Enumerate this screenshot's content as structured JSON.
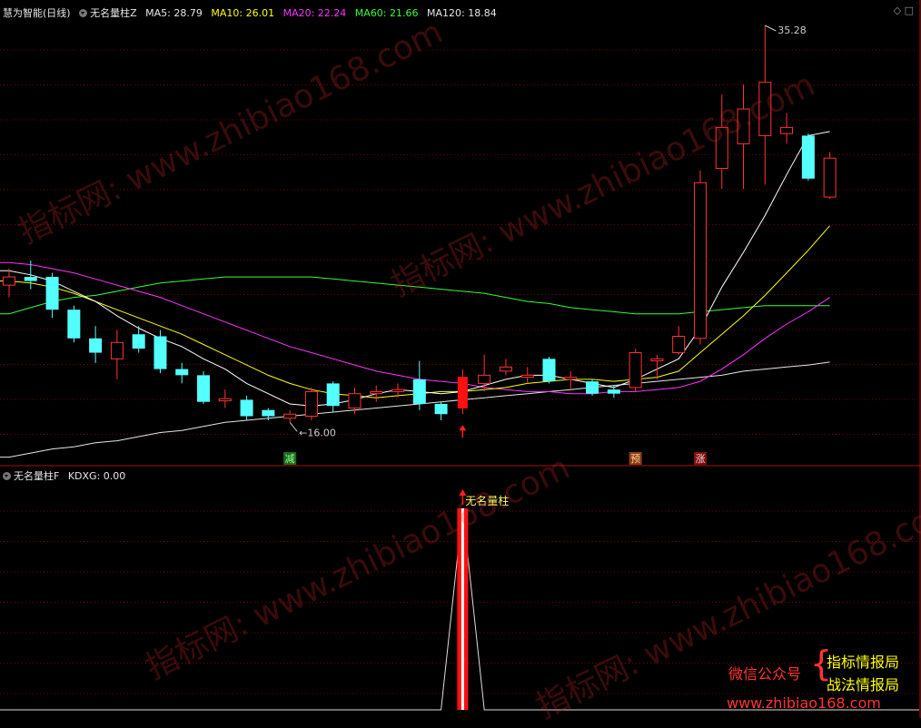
{
  "app": {
    "title": "慧为智能(日线)"
  },
  "main_panel": {
    "indicator_name": "无名量柱Z",
    "ma": [
      {
        "label": "MA5: 28.79",
        "color": "#ffffff"
      },
      {
        "label": "MA10: 26.01",
        "color": "#ffff00"
      },
      {
        "label": "MA20: 22.24",
        "color": "#ff33ff"
      },
      {
        "label": "MA60: 21.66",
        "color": "#33ff33"
      },
      {
        "label": "MA120: 18.84",
        "color": "#e6e6e6"
      }
    ],
    "high_label": "35.28",
    "low_label": "16.00",
    "signal_tags": [
      "减",
      "预",
      "涨"
    ]
  },
  "sub_panel": {
    "indicator_name": "无名量柱F",
    "kdxg_label": "KDXG: 0.00",
    "spike_label": "无名量柱"
  },
  "watermark": {
    "text": "指标网: www.zhibiao168.com"
  },
  "promo": {
    "wechat": "微信公众号",
    "line1": "指标情报局",
    "line2": "战法情报局",
    "url": "www.zhibiao168.com"
  },
  "colors": {
    "up": "#ff3333",
    "down": "#54ffff",
    "ma5": "#ffffff",
    "ma10": "#ffff00",
    "ma20": "#ff33ff",
    "ma60": "#33ff33",
    "ma120": "#e6e6e6"
  },
  "chart_data": {
    "type": "candlestick",
    "y_max": 35.28,
    "y_min": 16.0,
    "candles": [
      {
        "o": 22.6,
        "c": 23.0,
        "h": 23.4,
        "l": 22.0
      },
      {
        "o": 23.0,
        "c": 22.8,
        "h": 23.8,
        "l": 22.4
      },
      {
        "o": 23.0,
        "c": 21.4,
        "h": 23.2,
        "l": 21.0
      },
      {
        "o": 21.4,
        "c": 20.0,
        "h": 21.6,
        "l": 19.8
      },
      {
        "o": 20.0,
        "c": 19.3,
        "h": 20.6,
        "l": 18.8
      },
      {
        "o": 19.0,
        "c": 19.8,
        "h": 20.4,
        "l": 18.0
      },
      {
        "o": 20.2,
        "c": 19.5,
        "h": 20.6,
        "l": 19.3
      },
      {
        "o": 20.1,
        "c": 18.5,
        "h": 20.4,
        "l": 18.3
      },
      {
        "o": 18.5,
        "c": 18.2,
        "h": 18.8,
        "l": 17.8
      },
      {
        "o": 18.2,
        "c": 16.9,
        "h": 18.4,
        "l": 16.8
      },
      {
        "o": 16.95,
        "c": 17.05,
        "h": 17.5,
        "l": 16.6
      },
      {
        "o": 17.0,
        "c": 16.2,
        "h": 17.2,
        "l": 16.0
      },
      {
        "o": 16.5,
        "c": 16.2,
        "h": 16.6,
        "l": 16.0
      },
      {
        "o": 16.1,
        "c": 16.3,
        "h": 16.5,
        "l": 15.9
      },
      {
        "o": 16.2,
        "c": 17.4,
        "h": 17.6,
        "l": 16.0
      },
      {
        "o": 17.8,
        "c": 16.7,
        "h": 17.9,
        "l": 16.4
      },
      {
        "o": 16.6,
        "c": 17.3,
        "h": 17.6,
        "l": 16.3
      },
      {
        "o": 17.3,
        "c": 17.4,
        "h": 17.7,
        "l": 16.9
      },
      {
        "o": 17.4,
        "c": 17.5,
        "h": 17.8,
        "l": 17.1
      },
      {
        "o": 18.0,
        "c": 16.8,
        "h": 18.9,
        "l": 16.5
      },
      {
        "o": 16.8,
        "c": 16.3,
        "h": 16.9,
        "l": 16.0
      },
      {
        "o": 16.6,
        "c": 18.1,
        "h": 18.5,
        "l": 16.3
      },
      {
        "o": 17.8,
        "c": 18.2,
        "h": 19.2,
        "l": 17.4
      },
      {
        "o": 18.4,
        "c": 18.6,
        "h": 19.0,
        "l": 18.2
      },
      {
        "o": 18.1,
        "c": 18.2,
        "h": 18.6,
        "l": 17.8
      },
      {
        "o": 19.0,
        "c": 17.9,
        "h": 19.1,
        "l": 17.8
      },
      {
        "o": 18.0,
        "c": 18.1,
        "h": 18.4,
        "l": 17.5
      },
      {
        "o": 17.9,
        "c": 17.3,
        "h": 18.0,
        "l": 17.2
      },
      {
        "o": 17.5,
        "c": 17.3,
        "h": 17.7,
        "l": 17.1
      },
      {
        "o": 17.6,
        "c": 19.3,
        "h": 19.5,
        "l": 17.4
      },
      {
        "o": 18.9,
        "c": 19.0,
        "h": 19.2,
        "l": 18.0
      },
      {
        "o": 19.3,
        "c": 20.1,
        "h": 20.6,
        "l": 19.2
      },
      {
        "o": 20.0,
        "c": 27.6,
        "h": 28.2,
        "l": 19.7
      },
      {
        "o": 28.3,
        "c": 30.3,
        "h": 31.9,
        "l": 27.3
      },
      {
        "o": 29.5,
        "c": 31.2,
        "h": 32.4,
        "l": 27.3
      },
      {
        "o": 29.9,
        "c": 32.5,
        "h": 35.28,
        "l": 27.5
      },
      {
        "o": 30.0,
        "c": 30.3,
        "h": 31.0,
        "l": 29.5
      },
      {
        "o": 29.9,
        "c": 27.8,
        "h": 30.0,
        "l": 27.7
      },
      {
        "o": 26.9,
        "c": 28.8,
        "h": 29.1,
        "l": 26.8
      }
    ],
    "ma5": [
      23.3,
      23.1,
      22.8,
      22.3,
      21.8,
      21.1,
      20.5,
      20.0,
      19.6,
      19.0,
      18.5,
      17.8,
      17.3,
      16.8,
      16.7,
      16.8,
      17.0,
      17.3,
      17.5,
      17.4,
      17.3,
      17.4,
      17.7,
      18.0,
      18.2,
      18.2,
      18.0,
      17.8,
      17.6,
      18.0,
      18.5,
      19.0,
      20.5,
      22.5,
      24.2,
      26.0,
      28.0,
      29.9,
      30.1
    ],
    "ma10": [
      22.8,
      22.7,
      22.5,
      22.2,
      21.8,
      21.4,
      21.0,
      20.6,
      20.2,
      19.7,
      19.2,
      18.7,
      18.2,
      17.8,
      17.5,
      17.3,
      17.2,
      17.1,
      17.2,
      17.3,
      17.4,
      17.4,
      17.5,
      17.6,
      17.8,
      17.9,
      18.0,
      18.0,
      17.9,
      18.0,
      18.1,
      18.4,
      19.3,
      20.2,
      21.1,
      22.1,
      23.2,
      24.3,
      25.5
    ],
    "ma20": [
      23.7,
      23.6,
      23.4,
      23.2,
      22.9,
      22.6,
      22.3,
      22.0,
      21.6,
      21.2,
      20.8,
      20.4,
      20.0,
      19.6,
      19.3,
      19.0,
      18.7,
      18.4,
      18.2,
      18.0,
      17.9,
      17.8,
      17.6,
      17.5,
      17.4,
      17.4,
      17.3,
      17.3,
      17.4,
      17.4,
      17.5,
      17.6,
      17.9,
      18.5,
      19.2,
      20.0,
      20.7,
      21.3,
      22.0
    ],
    "ma60": [
      21.2,
      21.5,
      21.8,
      22.0,
      22.1,
      22.3,
      22.5,
      22.7,
      22.8,
      22.9,
      23.0,
      23.0,
      23.0,
      23.0,
      23.0,
      22.9,
      22.8,
      22.7,
      22.6,
      22.5,
      22.4,
      22.3,
      22.2,
      22.0,
      21.8,
      21.7,
      21.5,
      21.4,
      21.3,
      21.2,
      21.2,
      21.2,
      21.3,
      21.4,
      21.5,
      21.6,
      21.6,
      21.6,
      21.6
    ],
    "ma120": [
      14.2,
      14.4,
      14.6,
      14.7,
      14.9,
      15.0,
      15.2,
      15.4,
      15.5,
      15.7,
      15.9,
      16.0,
      16.1,
      16.2,
      16.3,
      16.4,
      16.5,
      16.6,
      16.7,
      16.8,
      16.9,
      17.0,
      17.1,
      17.2,
      17.3,
      17.4,
      17.5,
      17.6,
      17.7,
      17.8,
      17.9,
      18.0,
      18.1,
      18.2,
      18.4,
      18.5,
      18.6,
      18.7,
      18.84
    ],
    "volume_indicator": [
      0,
      0,
      0,
      0,
      0,
      0,
      0,
      0,
      0,
      0,
      0,
      0,
      0,
      0,
      0,
      0,
      0,
      0,
      0,
      0,
      0,
      1,
      0,
      0,
      0,
      0,
      0,
      0,
      0,
      0,
      0,
      0,
      0,
      0,
      0,
      0,
      0,
      0,
      0
    ],
    "signal_arrow_index": 21,
    "tag_indices": [
      13,
      29,
      32
    ]
  }
}
